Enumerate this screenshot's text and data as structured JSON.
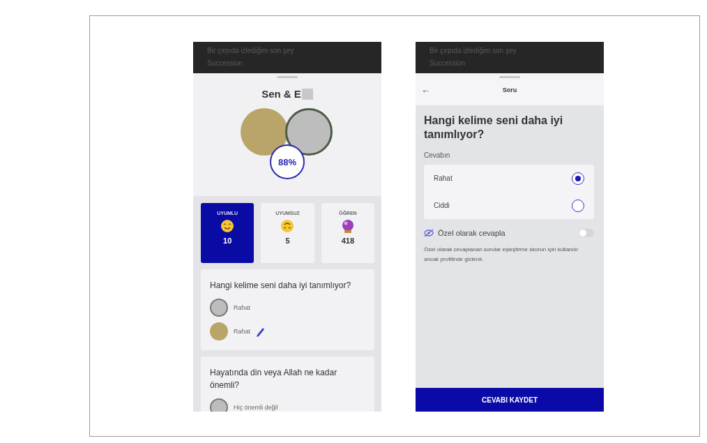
{
  "left_screen": {
    "banner": {
      "line_1": "Bir çırpıda izlediğim son şey",
      "line_2": "Succession"
    },
    "title": "Sen & E",
    "match_percent": "88%",
    "stats": [
      {
        "label": "UYUMLU",
        "count": "10",
        "selected": true,
        "kind": "smile"
      },
      {
        "label": "UYUMSUZ",
        "count": "5",
        "selected": false,
        "kind": "upside-down"
      },
      {
        "label": "ÖĞREN",
        "count": "418",
        "selected": false,
        "kind": "crystal-ball"
      }
    ],
    "cards": [
      {
        "question": "Hangi kelime seni daha iyi tanımlıyor?",
        "answers": [
          {
            "text": "Rahat",
            "kind": "blank",
            "editable": false
          },
          {
            "text": "Rahat",
            "kind": "photo",
            "editable": true
          }
        ]
      },
      {
        "question": "Hayatında din veya Allah ne kadar önemli?",
        "answers": [
          {
            "text": "Hiç önemli değil",
            "kind": "blank",
            "editable": false
          }
        ]
      }
    ]
  },
  "right_screen": {
    "banner": {
      "line_1": "Bir çırpıda izlediğim son şey",
      "line_2": "Succession"
    },
    "nav": {
      "back": "←",
      "title": "Soru"
    },
    "question": "Hangi kelime seni daha iyi tanımlıyor?",
    "answer_label": "Cevabın",
    "options": [
      {
        "label": "Rahat",
        "selected": true
      },
      {
        "label": "Ciddi",
        "selected": false
      }
    ],
    "private": {
      "label": "Özel olarak cevapla",
      "on": false
    },
    "note": "Özel olarak cevaplanan sorular eşleştirme skorun için kullanılır ancak profilinde gizlenir.",
    "save_button": "CEVABI KAYDET"
  }
}
